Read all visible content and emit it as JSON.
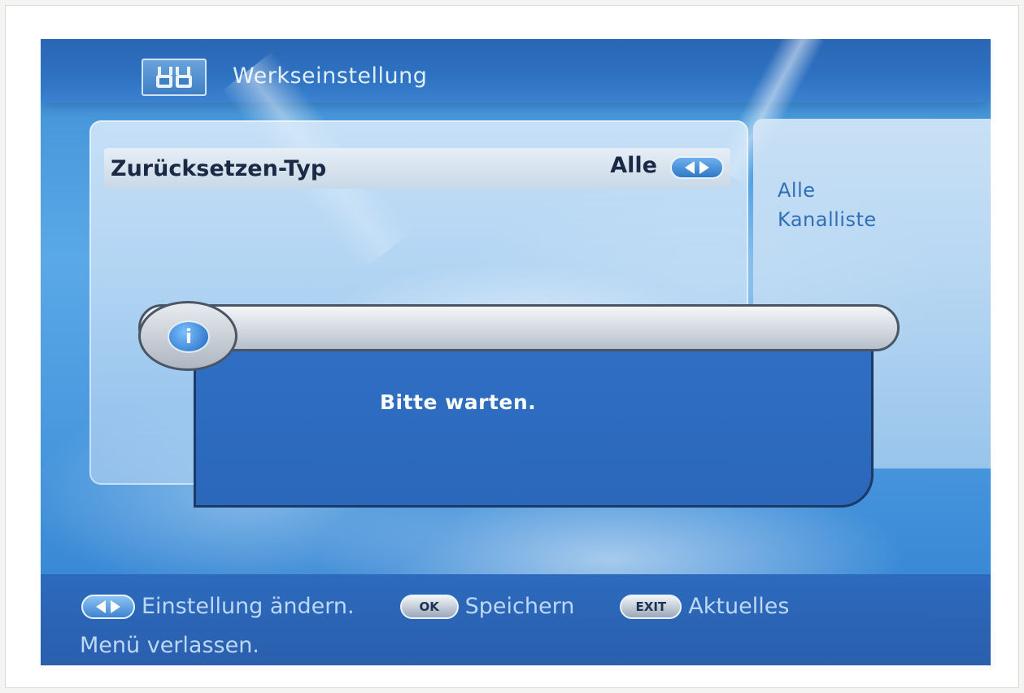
{
  "header": {
    "title": "Werkseinstellung"
  },
  "setting": {
    "label": "Zurücksetzen-Typ",
    "value": "Alle"
  },
  "options_panel": {
    "items": [
      "Alle",
      "Kanalliste"
    ]
  },
  "dialog": {
    "message": "Bitte warten.",
    "icon": "info-icon"
  },
  "footer": {
    "change_label": "Einstellung ändern.",
    "ok_key": "OK",
    "save_label": "Speichern",
    "exit_key": "EXIT",
    "exit_label": "Aktuelles",
    "exit_label_cont": "Menü verlassen."
  }
}
